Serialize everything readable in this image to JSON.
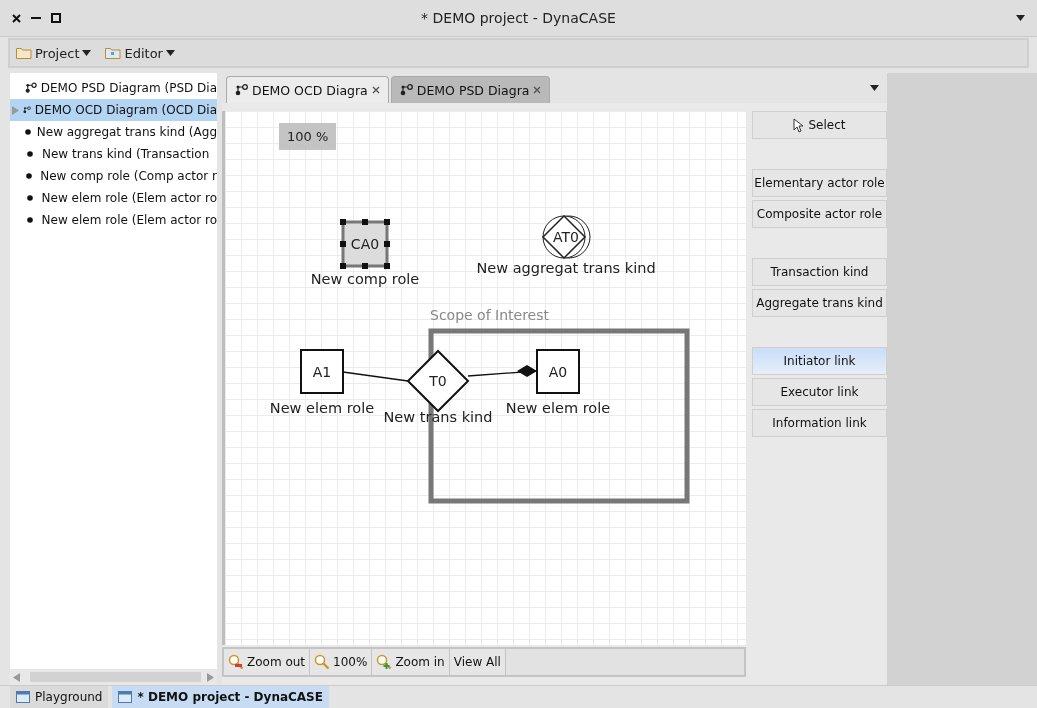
{
  "window": {
    "title": "* DEMO project - DynaCASE"
  },
  "menus": [
    {
      "label": "Project"
    },
    {
      "label": "Editor"
    }
  ],
  "tree": {
    "items": [
      {
        "label": "DEMO PSD Diagram (PSD Dia",
        "kind": "diagram",
        "selected": false,
        "expandable": false
      },
      {
        "label": "DEMO OCD Diagram (OCD Dia",
        "kind": "diagram",
        "selected": true,
        "expandable": true
      },
      {
        "label": "New aggregat trans kind (Agg",
        "kind": "element",
        "selected": false,
        "expandable": false
      },
      {
        "label": "New trans kind (Transaction",
        "kind": "element",
        "selected": false,
        "expandable": false
      },
      {
        "label": "New comp role (Comp actor r",
        "kind": "element",
        "selected": false,
        "expandable": false
      },
      {
        "label": "New elem role (Elem actor ro",
        "kind": "element",
        "selected": false,
        "expandable": false
      },
      {
        "label": "New elem role (Elem actor ro",
        "kind": "element",
        "selected": false,
        "expandable": false
      }
    ]
  },
  "tabs": [
    {
      "label": "DEMO OCD Diagra",
      "selected": true
    },
    {
      "label": "DEMO PSD Diagra",
      "selected": false
    }
  ],
  "canvas": {
    "zoom_label": "100 %",
    "scope": {
      "label": "Scope of Interest"
    },
    "nodes": [
      {
        "kind": "composite",
        "code": "CA0",
        "name": "New comp role",
        "selected": true
      },
      {
        "kind": "aggregate",
        "code": "AT0",
        "name": "New aggregat trans kind",
        "selected": false
      },
      {
        "kind": "elementary",
        "code": "A1",
        "name": "New elem role",
        "selected": false
      },
      {
        "kind": "transaction",
        "code": "T0",
        "name": "New trans kind",
        "selected": false
      },
      {
        "kind": "elementary",
        "code": "A0",
        "name": "New elem role",
        "selected": false
      }
    ],
    "links": [
      {
        "kind": "initiator"
      },
      {
        "kind": "executor"
      }
    ]
  },
  "palette": [
    {
      "buttons": [
        {
          "label": "Select",
          "kind": "select",
          "selected": false
        }
      ]
    },
    {
      "buttons": [
        {
          "label": "Elementary actor role",
          "kind": "tool",
          "selected": false
        },
        {
          "label": "Composite actor role",
          "kind": "tool",
          "selected": false
        }
      ]
    },
    {
      "buttons": [
        {
          "label": "Transaction kind",
          "kind": "tool",
          "selected": false
        },
        {
          "label": "Aggregate trans kind",
          "kind": "tool",
          "selected": false
        }
      ]
    },
    {
      "buttons": [
        {
          "label": "Initiator link",
          "kind": "tool",
          "selected": true
        },
        {
          "label": "Executor link",
          "kind": "tool",
          "selected": false
        },
        {
          "label": "Information link",
          "kind": "tool",
          "selected": false
        }
      ]
    }
  ],
  "zoom_bar": [
    {
      "label": "Zoom out",
      "kind": "zoom_out"
    },
    {
      "label": "100%",
      "kind": "reset"
    },
    {
      "label": "Zoom in",
      "kind": "zoom_in"
    },
    {
      "label": "View All",
      "kind": "all"
    }
  ],
  "taskbar": [
    {
      "label": "Playground",
      "selected": false
    },
    {
      "label": "* DEMO project - DynaCASE",
      "selected": true
    }
  ]
}
